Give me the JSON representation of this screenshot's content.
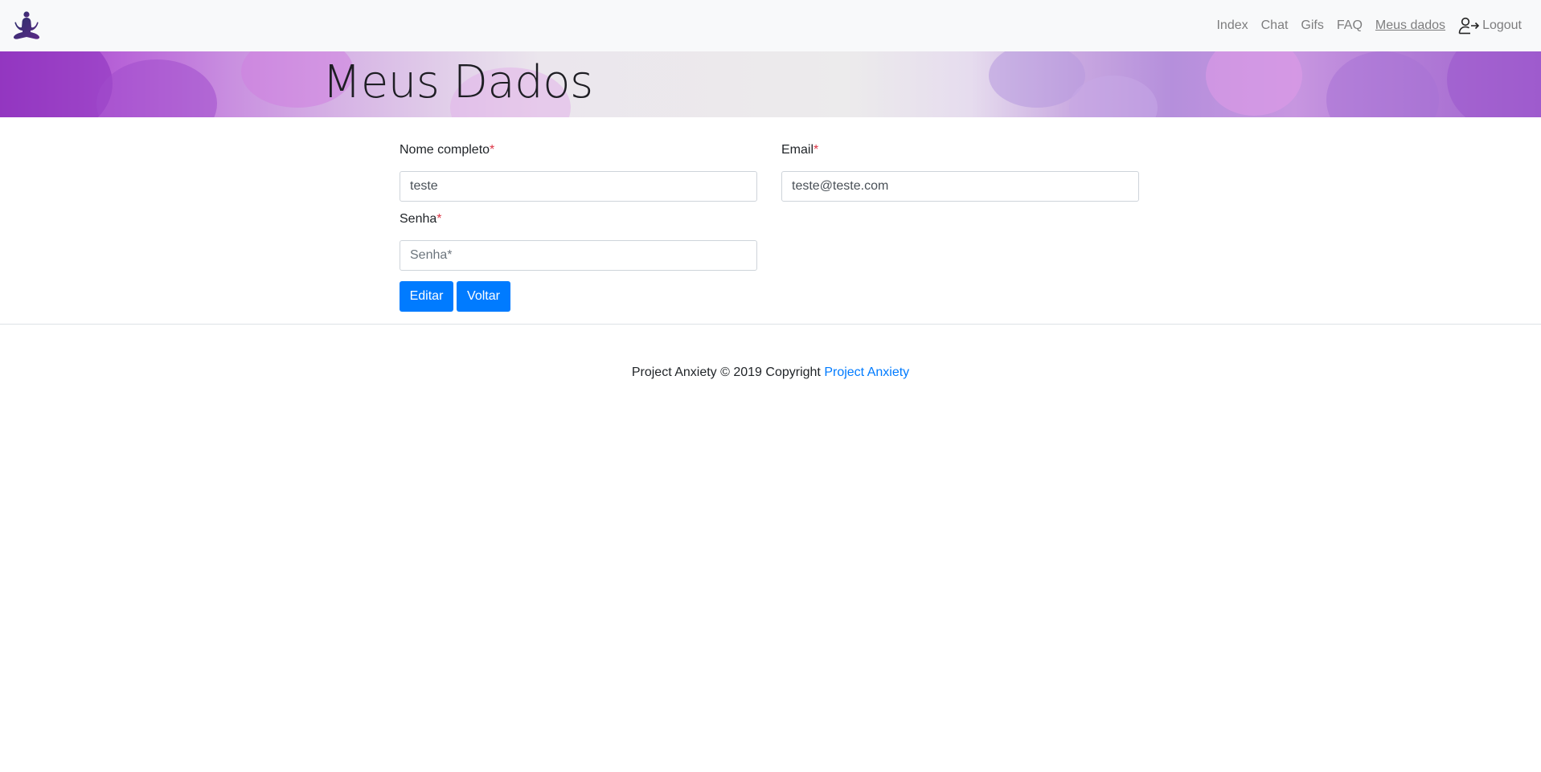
{
  "navbar": {
    "logo_icon": "meditation-figure-icon",
    "links": [
      {
        "label": "Index"
      },
      {
        "label": "Chat"
      },
      {
        "label": "Gifs"
      },
      {
        "label": "FAQ"
      },
      {
        "label": "Meus dados",
        "active": true
      }
    ],
    "logout": {
      "label": "Logout",
      "icon": "user-logout-icon"
    }
  },
  "banner": {
    "title": "Meus Dados"
  },
  "form": {
    "name": {
      "label": "Nome completo",
      "required_mark": "*",
      "value": "teste"
    },
    "email": {
      "label": "Email",
      "required_mark": "*",
      "value": "teste@teste.com"
    },
    "password": {
      "label": "Senha",
      "required_mark": "*",
      "value": "",
      "placeholder": "Senha*"
    },
    "buttons": {
      "edit": "Editar",
      "back": "Voltar"
    }
  },
  "footer": {
    "text": "Project Anxiety © 2019 Copyright",
    "link": "Project Anxiety"
  },
  "colors": {
    "primary": "#007bff",
    "required": "#dc3545",
    "navbar_bg": "#f8f9fa"
  }
}
